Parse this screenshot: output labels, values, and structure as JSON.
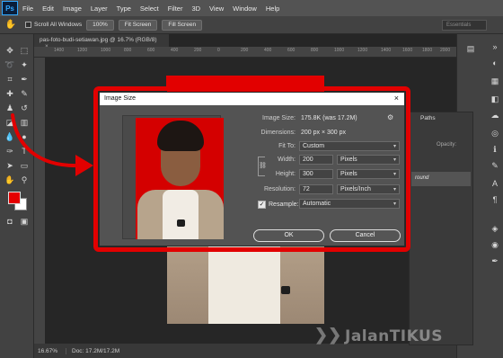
{
  "app": {
    "logo": "Ps"
  },
  "menu": [
    "File",
    "Edit",
    "Image",
    "Layer",
    "Type",
    "Select",
    "Filter",
    "3D",
    "View",
    "Window",
    "Help"
  ],
  "options_bar": {
    "scroll_all_windows": "Scroll All Windows",
    "zoom_btn": "100%",
    "fit_screen_btn": "Fit Screen",
    "fill_screen_btn": "Fill Screen",
    "workspace": "Essentials"
  },
  "document": {
    "tab_title": "pas-foto-budi-setiawan.jpg @ 16.7% (RGB/8)",
    "close_glyph": "×"
  },
  "ruler": {
    "ticks": [
      "1400",
      "1200",
      "1000",
      "800",
      "600",
      "400",
      "200",
      "0",
      "200",
      "400",
      "600",
      "800",
      "1000",
      "1200",
      "1400",
      "1600",
      "1800",
      "2000"
    ]
  },
  "status": {
    "zoom": "16.67%",
    "doc_info": "Doc: 17.2M/17.2M"
  },
  "layers_panel": {
    "tab": "Paths",
    "opacity_label": "Opacity:",
    "layer_name": "round"
  },
  "dialog": {
    "title": "Image Size",
    "close_glyph": "×",
    "image_size_label": "Image Size:",
    "image_size_value": "175.8K (was 17.2M)",
    "dimensions_label": "Dimensions:",
    "dimensions_value": "200 px  ×  300 px",
    "fit_to_label": "Fit To:",
    "fit_to_value": "Custom",
    "width_label": "Width:",
    "width_value": "200",
    "width_unit": "Pixels",
    "height_label": "Height:",
    "height_value": "300",
    "height_unit": "Pixels",
    "resolution_label": "Resolution:",
    "resolution_value": "72",
    "resolution_unit": "Pixels/Inch",
    "resample_label": "Resample:",
    "resample_checked": true,
    "resample_value": "Automatic",
    "ok_label": "OK",
    "cancel_label": "Cancel"
  },
  "watermark": "JalanTIKUS",
  "colors": {
    "highlight": "#e20000",
    "foreground": "#e50000",
    "background": "#ffffff",
    "ps_blue": "#31a8ff"
  },
  "icons": [
    "move-icon",
    "marquee-icon",
    "lasso-icon",
    "magic-wand-icon",
    "crop-icon",
    "eyedropper-icon",
    "healing-icon",
    "brush-icon",
    "stamp-icon",
    "history-brush-icon",
    "eraser-icon",
    "gradient-icon",
    "blur-icon",
    "dodge-icon",
    "pen-icon",
    "type-icon",
    "path-select-icon",
    "shape-icon",
    "hand-icon",
    "zoom-icon",
    "gear-icon",
    "chain-link-icon"
  ]
}
